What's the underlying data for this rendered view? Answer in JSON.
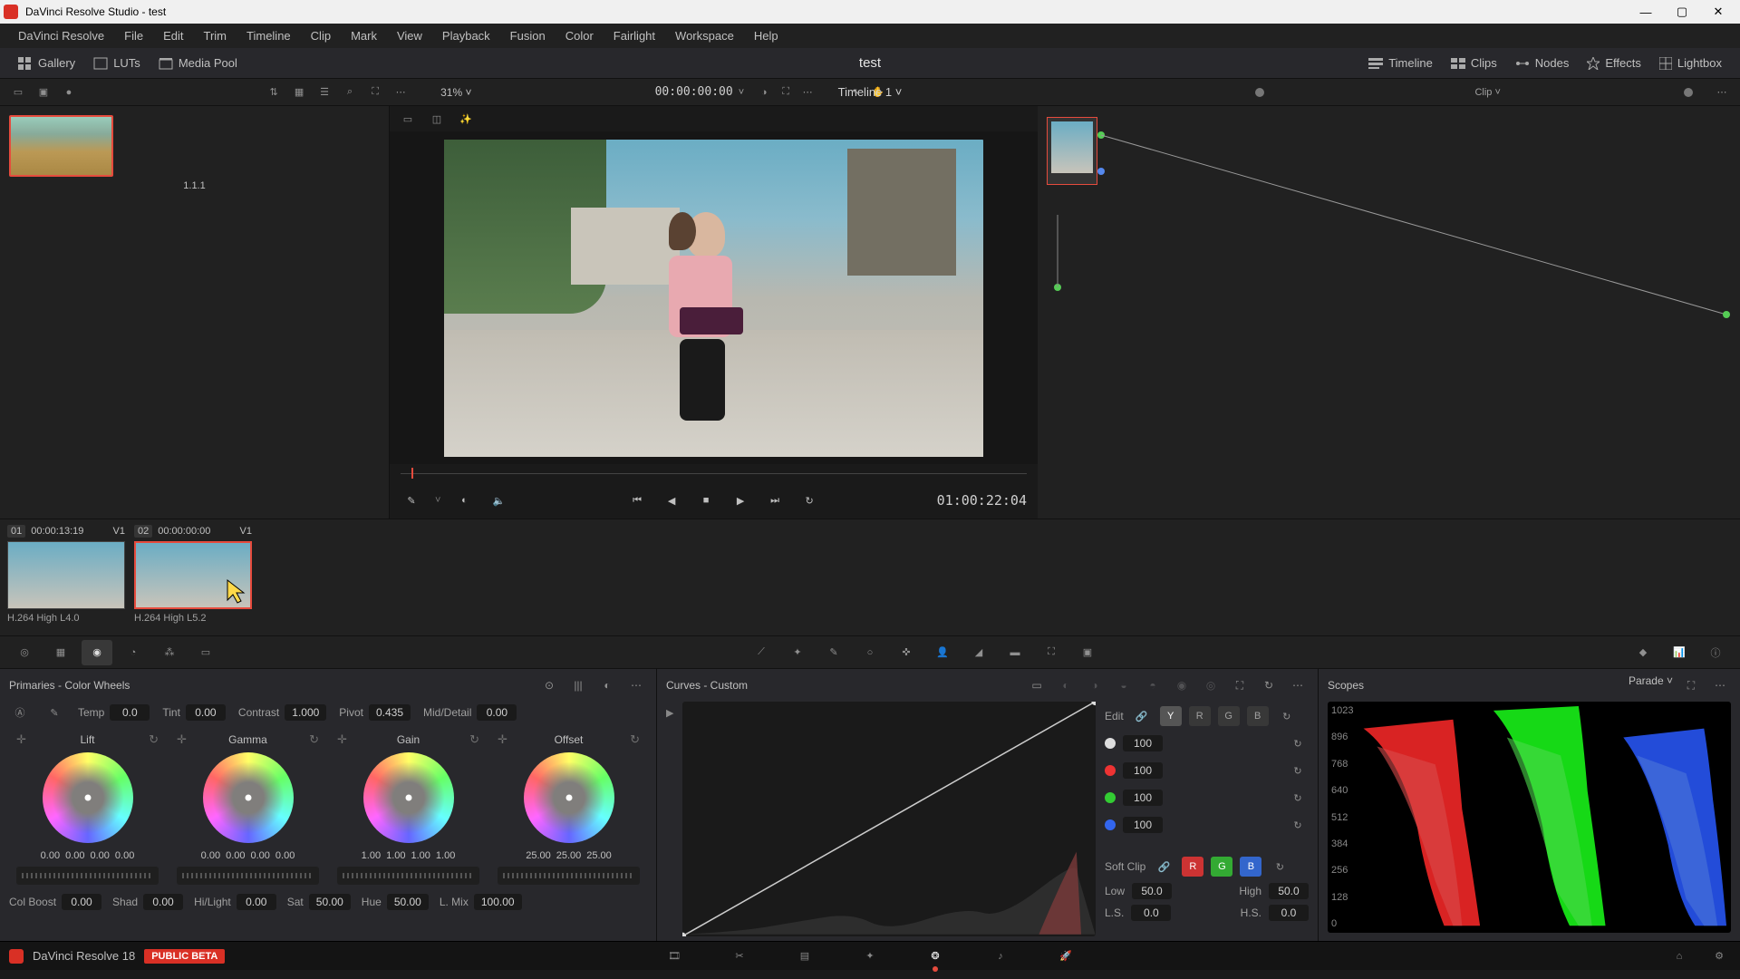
{
  "window_title": "DaVinci Resolve Studio - test",
  "menubar": [
    "DaVinci Resolve",
    "File",
    "Edit",
    "Trim",
    "Timeline",
    "Clip",
    "Mark",
    "View",
    "Playback",
    "Fusion",
    "Color",
    "Fairlight",
    "Workspace",
    "Help"
  ],
  "top_toolbar": {
    "gallery": "Gallery",
    "luts": "LUTs",
    "media_pool": "Media Pool",
    "project_name": "test",
    "right": {
      "timeline": "Timeline",
      "clips": "Clips",
      "nodes": "Nodes",
      "effects": "Effects",
      "lightbox": "Lightbox"
    }
  },
  "secondary": {
    "zoom": "31%",
    "timeline_name": "Timeline 1",
    "timecode": "00:00:00:00",
    "clip_mode": "Clip"
  },
  "gallery_thumb_label": "1.1.1",
  "viewer": {
    "timecode": "01:00:22:04"
  },
  "clips": [
    {
      "num": "01",
      "tc": "00:00:13:19",
      "track": "V1",
      "codec": "H.264 High L4.0",
      "selected": false
    },
    {
      "num": "02",
      "tc": "00:00:00:00",
      "track": "V1",
      "codec": "H.264 High L5.2",
      "selected": true
    }
  ],
  "primaries": {
    "title": "Primaries - Color Wheels",
    "params_top": {
      "temp": {
        "label": "Temp",
        "value": "0.0"
      },
      "tint": {
        "label": "Tint",
        "value": "0.00"
      },
      "contrast": {
        "label": "Contrast",
        "value": "1.000"
      },
      "pivot": {
        "label": "Pivot",
        "value": "0.435"
      },
      "mid_detail": {
        "label": "Mid/Detail",
        "value": "0.00"
      }
    },
    "wheels": {
      "lift": {
        "label": "Lift",
        "values": [
          "0.00",
          "0.00",
          "0.00",
          "0.00"
        ]
      },
      "gamma": {
        "label": "Gamma",
        "values": [
          "0.00",
          "0.00",
          "0.00",
          "0.00"
        ]
      },
      "gain": {
        "label": "Gain",
        "values": [
          "1.00",
          "1.00",
          "1.00",
          "1.00"
        ]
      },
      "offset": {
        "label": "Offset",
        "values": [
          "25.00",
          "25.00",
          "25.00"
        ]
      }
    },
    "footer": {
      "col_boost": {
        "label": "Col Boost",
        "value": "0.00"
      },
      "shad": {
        "label": "Shad",
        "value": "0.00"
      },
      "hilight": {
        "label": "Hi/Light",
        "value": "0.00"
      },
      "sat": {
        "label": "Sat",
        "value": "50.00"
      },
      "hue": {
        "label": "Hue",
        "value": "50.00"
      },
      "lmix": {
        "label": "L. Mix",
        "value": "100.00"
      }
    }
  },
  "curves": {
    "title": "Curves - Custom",
    "edit_label": "Edit",
    "channels": [
      "Y",
      "R",
      "G",
      "B"
    ],
    "intensity": {
      "white": "100",
      "red": "100",
      "green": "100",
      "blue": "100"
    },
    "softclip": {
      "label": "Soft Clip",
      "low": {
        "label": "Low",
        "value": "50.0"
      },
      "high": {
        "label": "High",
        "value": "50.0"
      },
      "ls": {
        "label": "L.S.",
        "value": "0.0"
      },
      "hs": {
        "label": "H.S.",
        "value": "0.0"
      }
    }
  },
  "scopes": {
    "title": "Scopes",
    "mode": "Parade",
    "levels": [
      "1023",
      "896",
      "768",
      "640",
      "512",
      "384",
      "256",
      "128",
      "0"
    ]
  },
  "footer": {
    "app": "DaVinci Resolve 18",
    "badge": "PUBLIC BETA"
  }
}
